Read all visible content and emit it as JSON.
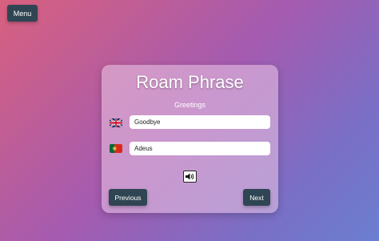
{
  "menu": {
    "label": "Menu"
  },
  "card": {
    "title": "Roam Phrase",
    "category": "Greetings",
    "source": {
      "language_flag": "uk-flag-icon",
      "value": "Goodbye"
    },
    "target": {
      "language_flag": "portugal-flag-icon",
      "value": "Adeus"
    },
    "speaker_icon": "speaker-icon",
    "previous_label": "Previous",
    "next_label": "Next"
  },
  "colors": {
    "button_bg": "#2f4553",
    "gradient_start": "#d9607e",
    "gradient_end": "#6a7fd0"
  }
}
